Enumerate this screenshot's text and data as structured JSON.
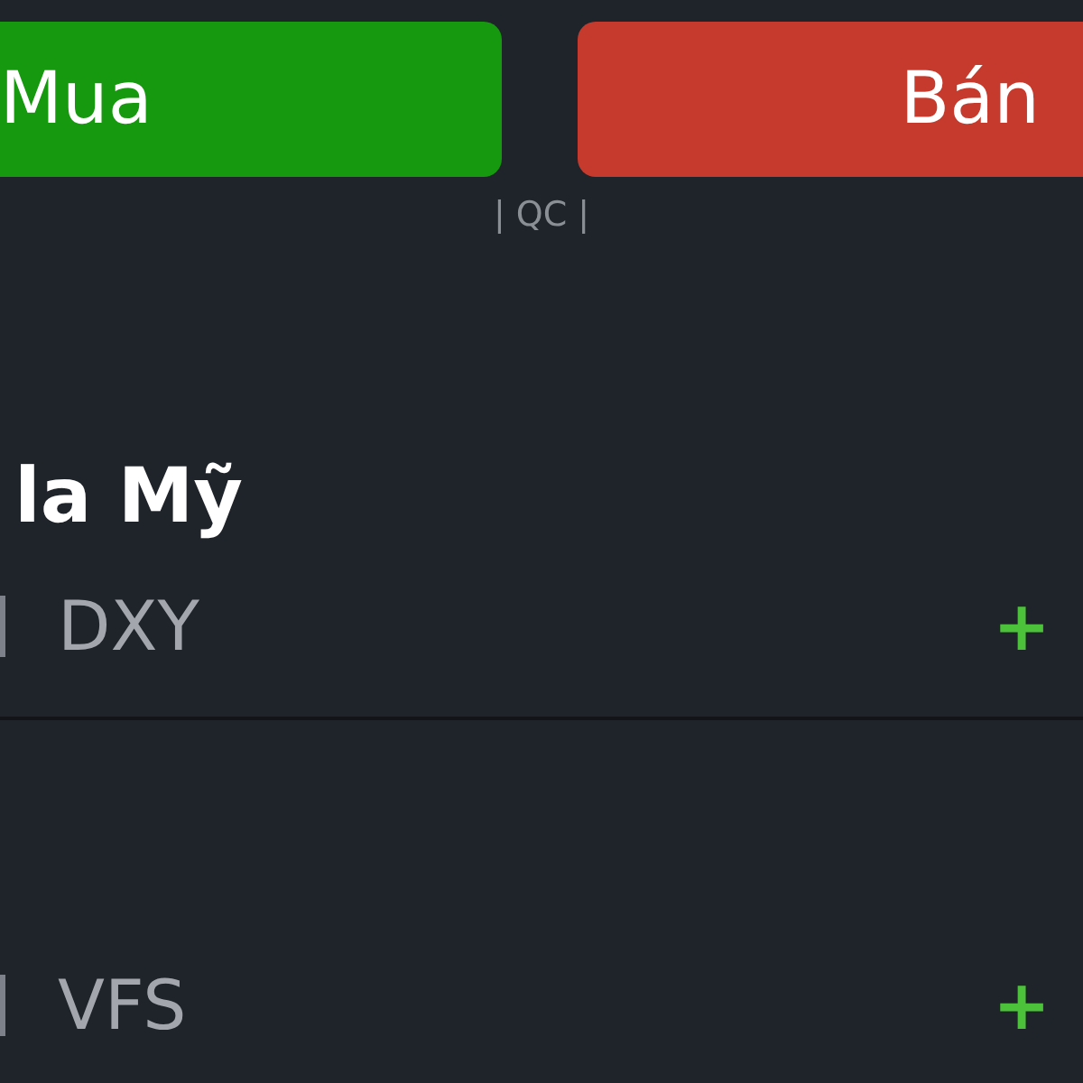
{
  "actions": [
    {
      "label": "Mua",
      "kind": "buy"
    },
    {
      "label": "Bán",
      "kind": "sell"
    }
  ],
  "ad_label": "| QC |",
  "section": {
    "title": "la Mỹ"
  },
  "rows": [
    {
      "symbol": "DXY",
      "change": "+"
    },
    {
      "symbol": "VFS",
      "change": "+"
    }
  ]
}
